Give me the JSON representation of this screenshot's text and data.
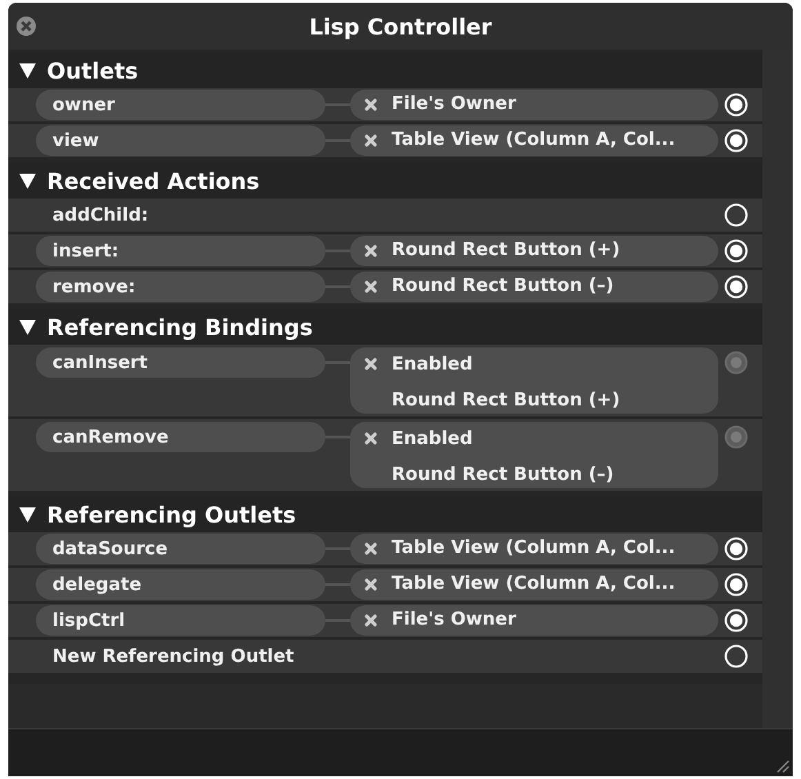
{
  "window": {
    "title": "Lisp Controller"
  },
  "sections": [
    {
      "title": "Outlets",
      "kind": "outlet",
      "expanded": true,
      "items": [
        {
          "name": "owner",
          "connected": true,
          "targets": [
            "File's Owner"
          ]
        },
        {
          "name": "view",
          "connected": true,
          "targets": [
            "Table View (Column A, Col..."
          ]
        }
      ]
    },
    {
      "title": "Received Actions",
      "kind": "outlet",
      "expanded": true,
      "items": [
        {
          "name": "addChild:",
          "connected": false
        },
        {
          "name": "insert:",
          "connected": true,
          "targets": [
            "Round Rect Button (+)"
          ]
        },
        {
          "name": "remove:",
          "connected": true,
          "targets": [
            "Round Rect Button (–)"
          ]
        }
      ]
    },
    {
      "title": "Referencing Bindings",
      "kind": "binding",
      "expanded": true,
      "items": [
        {
          "name": "canInsert",
          "connected": true,
          "targets": [
            "Enabled",
            "Round Rect Button (+)"
          ]
        },
        {
          "name": "canRemove",
          "connected": true,
          "targets": [
            "Enabled",
            "Round Rect Button (–)"
          ]
        }
      ]
    },
    {
      "title": "Referencing Outlets",
      "kind": "outlet",
      "expanded": true,
      "items": [
        {
          "name": "dataSource",
          "connected": true,
          "targets": [
            "Table View (Column A, Col..."
          ]
        },
        {
          "name": "delegate",
          "connected": true,
          "targets": [
            "Table View (Column A, Col..."
          ]
        },
        {
          "name": "lispCtrl",
          "connected": true,
          "targets": [
            "File's Owner"
          ]
        },
        {
          "name": "New Referencing Outlet",
          "connected": false
        }
      ]
    }
  ]
}
